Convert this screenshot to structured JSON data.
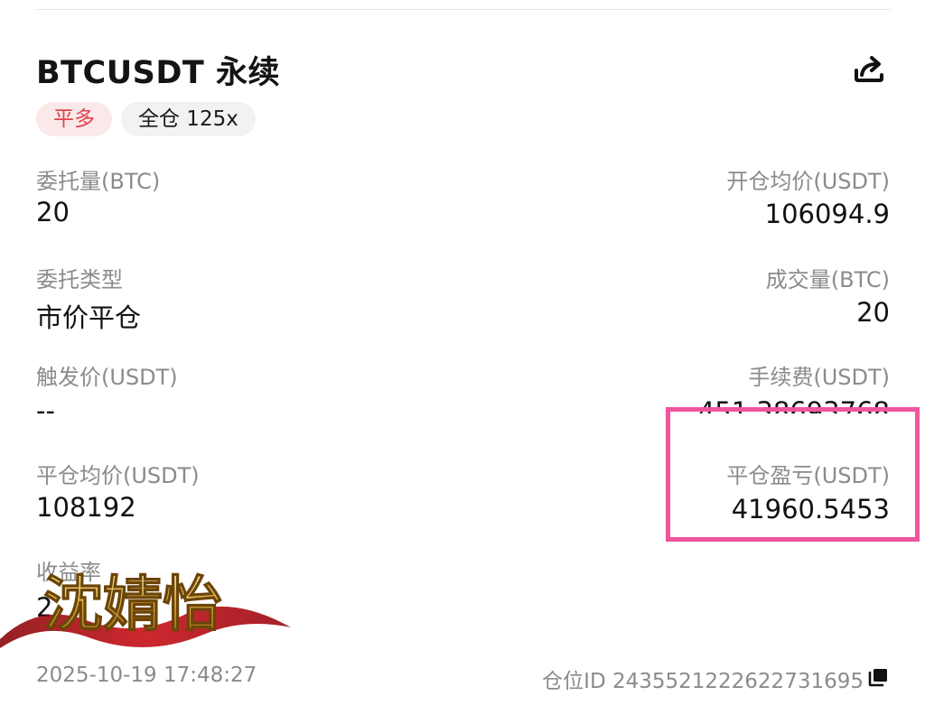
{
  "header": {
    "title": "BTCUSDT 永续",
    "share_icon": "share-icon"
  },
  "tags": {
    "side": "平多",
    "margin": "全仓 125x"
  },
  "fields": {
    "order_qty": {
      "label": "委托量(BTC)",
      "value": "20"
    },
    "open_avg_price": {
      "label": "开仓均价(USDT)",
      "value": "106094.9"
    },
    "order_type": {
      "label": "委托类型",
      "value": "市价平仓"
    },
    "filled_qty": {
      "label": "成交量(BTC)",
      "value": "20"
    },
    "trigger_price": {
      "label": "触发价(USDT)",
      "value": "--"
    },
    "fee": {
      "label": "手续费(USDT)",
      "value": "451.38693768"
    },
    "close_avg_price": {
      "label": "平仓均价(USDT)",
      "value": "108192"
    },
    "close_pnl": {
      "label": "平仓盈亏(USDT)",
      "value": "41960.5453"
    },
    "partial_row": {
      "label": "收益率",
      "value": "2"
    }
  },
  "footer": {
    "timestamp": "2025-10-19 17:48:27",
    "position_id": "仓位ID 2435521222622731695",
    "copy_icon": "copy-icon"
  },
  "watermark": {
    "text": "沈婧怡"
  },
  "colors": {
    "tag_side_bg": "#fbe9e9",
    "tag_side_text": "#e0424f",
    "highlight_border": "#f0559f",
    "label_gray": "#8b8b8b"
  }
}
